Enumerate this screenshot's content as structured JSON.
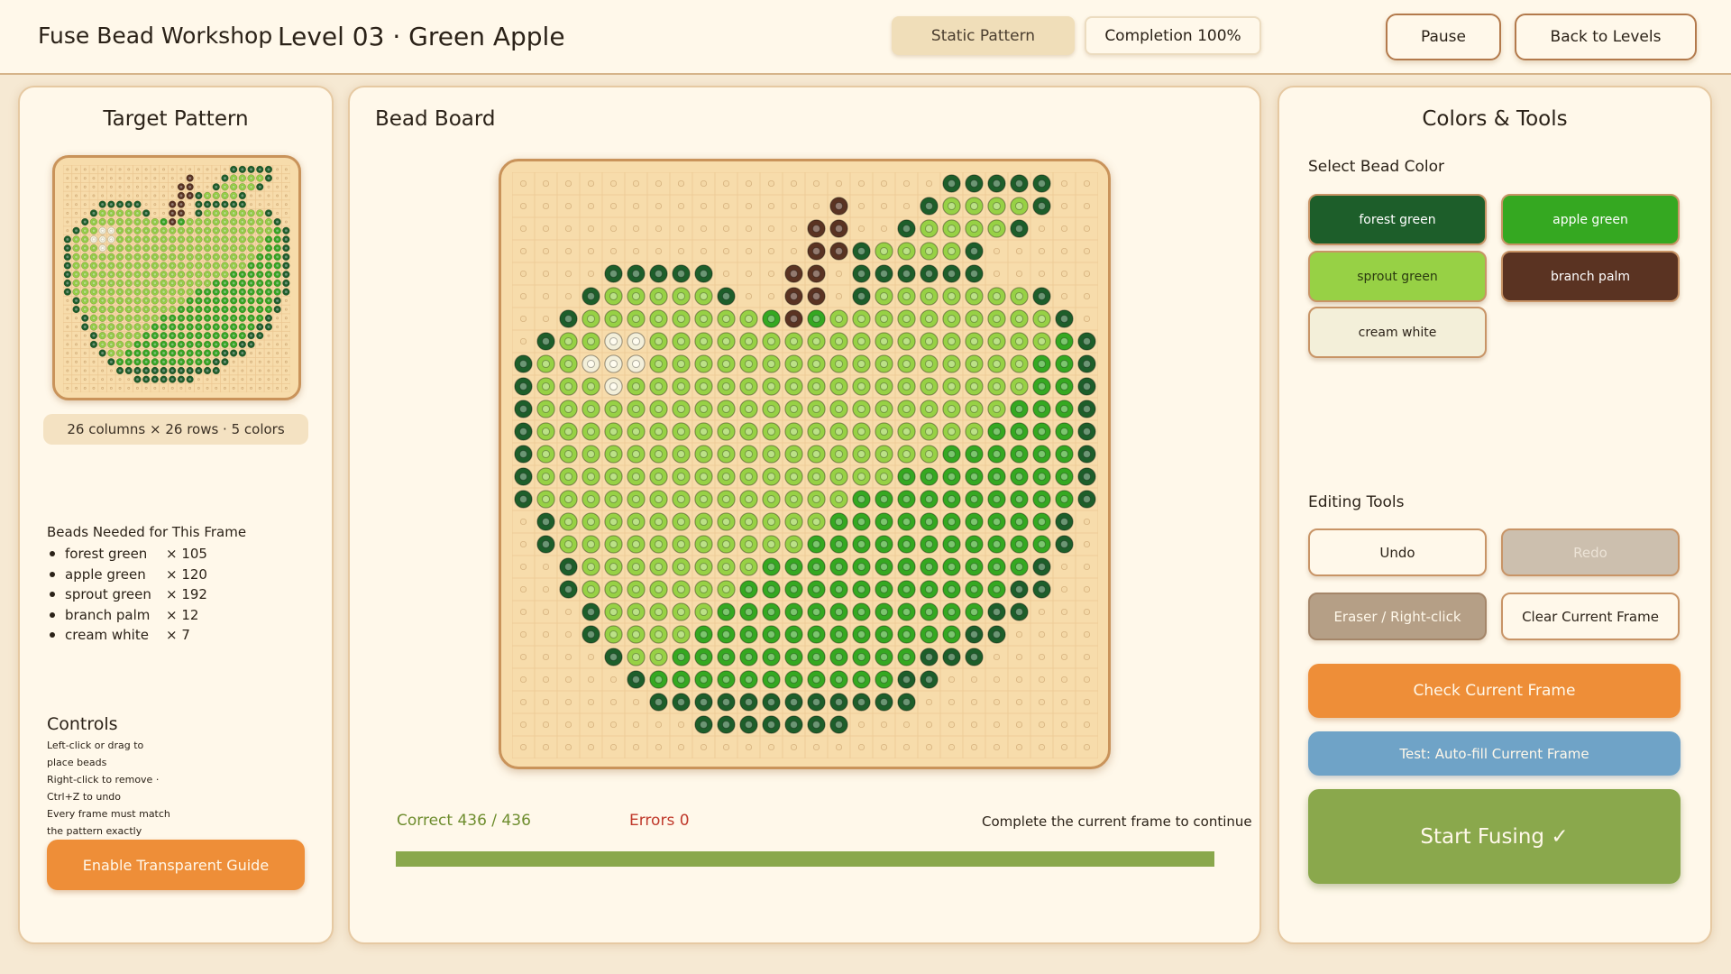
{
  "header": {
    "app_title": "Fuse Bead Workshop",
    "level_title": "Level 03 · Green Apple",
    "mode_label": "Static Pattern",
    "completion_label": "Completion 100%",
    "pause_label": "Pause",
    "back_label": "Back to Levels"
  },
  "left_panel": {
    "title": "Target Pattern",
    "dims": "26 columns × 26 rows · 5 colors",
    "beads_heading": "Beads Needed for This Frame",
    "beads": [
      {
        "name": "forest green",
        "count": "× 105"
      },
      {
        "name": "apple green",
        "count": "× 120"
      },
      {
        "name": "sprout green",
        "count": "× 192"
      },
      {
        "name": "branch palm",
        "count": "× 12"
      },
      {
        "name": "cream white",
        "count": "× 7"
      }
    ],
    "controls_title": "Controls",
    "controls_lines": [
      "Left-click or drag to",
      "place beads",
      "Right-click to remove ·",
      "Ctrl+Z to undo",
      "Every frame must match",
      "the pattern exactly"
    ],
    "guide_button": "Enable Transparent Guide"
  },
  "board": {
    "title": "Bead Board",
    "columns": 26,
    "rows": 26,
    "palette": {
      "F": "#1d5e2a",
      "A": "#35a821",
      "S": "#97d145",
      "B": "#5a3322",
      "C": "#f3efd9"
    },
    "pattern": [
      "...................FFFFF..",
      "..............B...FSSSSF..",
      ".............BB..FSSSSF...",
      ".............BBFSSSSF.....",
      "....FFFFF...BB.FFFFFF.....",
      "...FSSSSSF..BB.FSSSSSSSF..",
      "..FSSSSSSSSABASSSSSSSSSSF.",
      ".FSSCCSSSSSSSSSSSSSSSSSSAF",
      "FSSCCCSSSSSSSSSSSSSSSSSAAF",
      "FSSSCSSSSSSSSSSSSSSSSSSAAF",
      "FSSSSSSSSSSSSSSSSSSSSSAAAF",
      "FSSSSSSSSSSSSSSSSSSSSAAAAF",
      "FSSSSSSSSSSSSSSSSSSAAAAAAF",
      "FSSSSSSSSSSSSSSSSAAAAAAAAF",
      "FSSSSSSSSSSSSSSAAAAAAAAAAF",
      ".FSSSSSSSSSSSSAAAAAAAAAAF.",
      ".FSSSSSSSSSSSAAAAAAAAAAAF.",
      "..FSSSSSSSSAAAAAAAAAAAAF..",
      "..FSSSSSSSAAAAAAAAAAAAFF..",
      "...FSSSSSAAAAAAAAAAAAFF...",
      "...FSSSSAAAAAAAAAAAAFF....",
      "....FSSAAAAAAAAAAAFFF.....",
      ".....FAAAAAAAAAAAFF.......",
      "......FFFFFFFFFFFF........",
      "........FFFFFFF...........",
      ".........................."
    ],
    "correct_label": "Correct 436 / 436",
    "errors_label": "Errors 0",
    "hint": "Complete the current frame to continue",
    "progress": 1.0
  },
  "right_panel": {
    "title": "Colors & Tools",
    "color_heading": "Select Bead Color",
    "colors": [
      {
        "label": "forest green",
        "bg": "#1d5e2a",
        "fg": "#ffffff"
      },
      {
        "label": "apple green",
        "bg": "#35a821",
        "fg": "#ffffff"
      },
      {
        "label": "sprout green",
        "bg": "#97d145",
        "fg": "#2b3a10"
      },
      {
        "label": "branch palm",
        "bg": "#5a3322",
        "fg": "#ffffff"
      },
      {
        "label": "cream white",
        "bg": "#f3efd9",
        "fg": "#2b2218"
      }
    ],
    "tools_heading": "Editing Tools",
    "undo": "Undo",
    "redo": "Redo",
    "eraser": "Eraser / Right-click",
    "clear": "Clear Current Frame",
    "check": "Check Current Frame",
    "autofill": "Test: Auto-fill Current Frame",
    "start": "Start Fusing ✓"
  }
}
